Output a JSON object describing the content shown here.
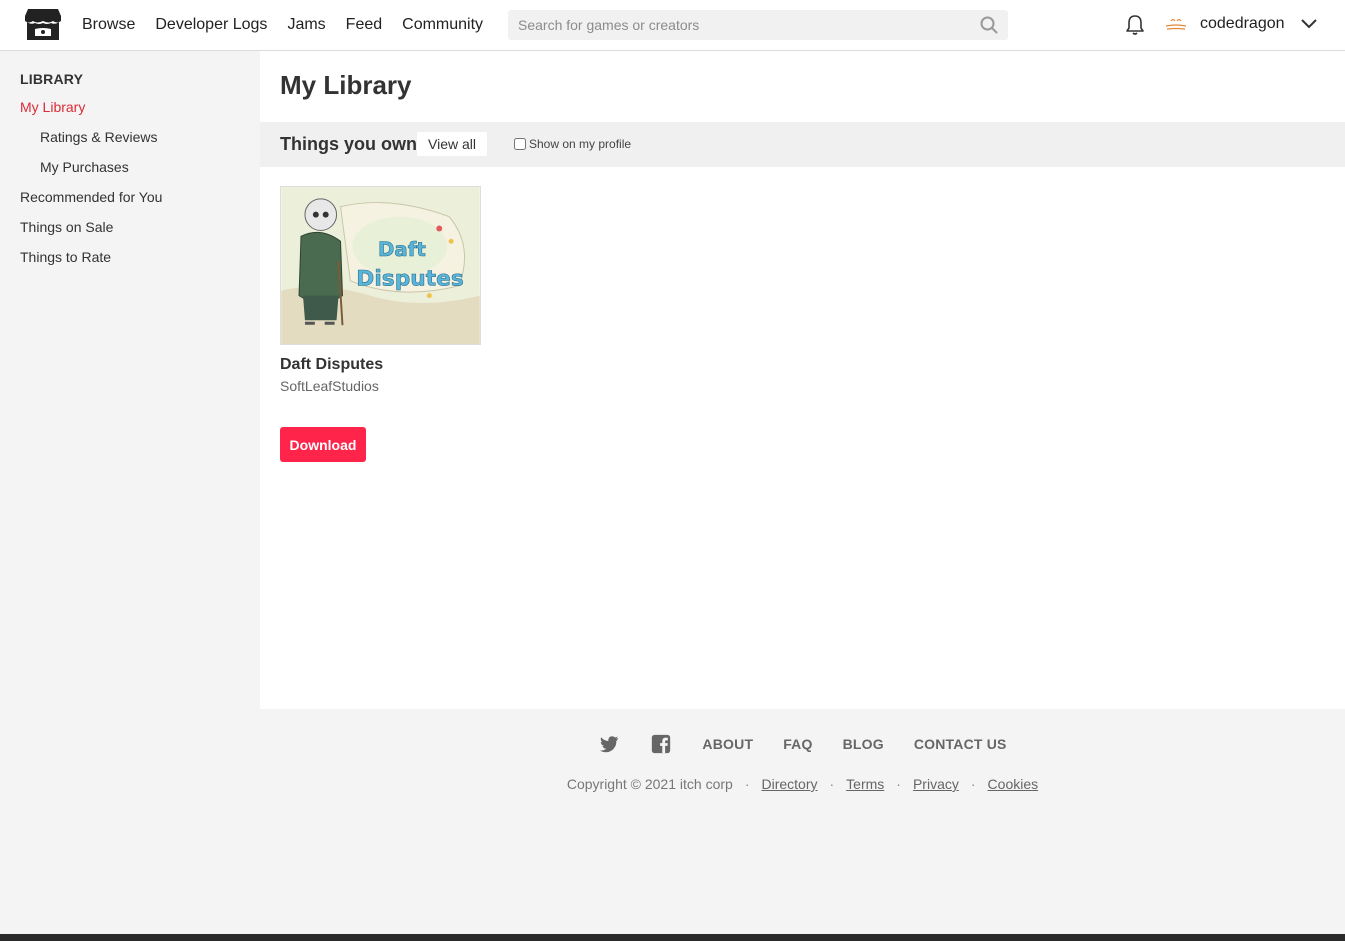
{
  "header": {
    "logo_icon": "itch-storefront-logo",
    "nav": [
      "Browse",
      "Developer Logs",
      "Jams",
      "Feed",
      "Community"
    ],
    "search_placeholder": "Search for games or creators",
    "search_icon": "search-icon",
    "notifications_icon": "bell-icon",
    "username": "codedragon",
    "menu_icon": "chevron-down-icon"
  },
  "sidebar": {
    "heading": "LIBRARY",
    "items": [
      {
        "label": "My Library",
        "active": true,
        "sub": false
      },
      {
        "label": "Ratings & Reviews",
        "active": false,
        "sub": true
      },
      {
        "label": "My Purchases",
        "active": false,
        "sub": true
      },
      {
        "label": "Recommended for You",
        "active": false,
        "sub": false
      },
      {
        "label": "Things on Sale",
        "active": false,
        "sub": false
      },
      {
        "label": "Things to Rate",
        "active": false,
        "sub": false
      }
    ]
  },
  "main": {
    "title": "My Library",
    "section_title": "Things you own",
    "view_all": "View all",
    "show_on_profile": "Show on my profile",
    "game": {
      "title": "Daft Disputes",
      "author": "SoftLeafStudios",
      "download_label": "Download"
    }
  },
  "footer": {
    "social": [
      "twitter-icon",
      "facebook-icon"
    ],
    "links": [
      "ABOUT",
      "FAQ",
      "BLOG",
      "CONTACT US"
    ],
    "copyright": "Copyright © 2021 itch corp",
    "legal": [
      "Directory",
      "Terms",
      "Privacy",
      "Cookies"
    ]
  },
  "colors": {
    "accent": "#da2c38",
    "download_button": "#ff2449"
  }
}
